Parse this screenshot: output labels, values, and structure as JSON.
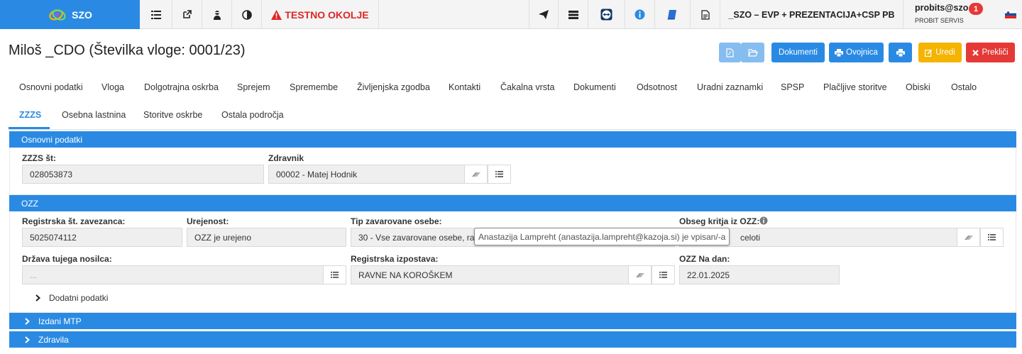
{
  "topbar": {
    "brand": "SZO",
    "env_warning": "TESTNO OKOLJE",
    "project": "_SZO – EVP + PREZENTACIJA+CSP PB",
    "user": "probits@szo",
    "organization": "PROBIT SERVIS",
    "notifications": "1",
    "icons": [
      "menu-list-icon",
      "external-link-icon",
      "user-secret-icon",
      "contrast-icon",
      "send-icon",
      "server-icon",
      "teamviewer-icon",
      "info-icon",
      "book-icon",
      "document-icon",
      "slovenia-flag-icon"
    ],
    "colors": {
      "brand_bg": "#2a8ae3",
      "warning": "#e02626",
      "badge": "#e53935"
    }
  },
  "header": {
    "title": "Miloš _CDO (Številka vloge: 0001/23)",
    "buttons": {
      "pdf_icon": "file-pdf-icon",
      "folder_icon": "folder-open-icon",
      "dokumenti": "Dokumenti",
      "ovojnica": "Ovojnica",
      "print_icon": "print-icon",
      "uredi": "Uredi",
      "preklici": "Prekliči"
    },
    "colors": {
      "primary": "#2a8ae3",
      "edit": "#f5b400",
      "cancel": "#e53935"
    }
  },
  "tabs": {
    "row1": [
      "Osnovni podatki",
      "Vloga",
      "Dolgotrajna oskrba",
      "Sprejem",
      "Spremembe",
      "Življenjska zgodba",
      "Kontakti",
      "Čakalna vrsta",
      "Dokumenti",
      "Odsotnost",
      "Uradni zaznamki",
      "SPSP",
      "Plačljive storitve",
      "Obiski",
      "Ostalo"
    ],
    "row2": [
      "ZZZS",
      "Osebna lastnina",
      "Storitve oskrbe",
      "Ostala področja"
    ],
    "active": "ZZZS"
  },
  "osnovni": {
    "heading": "Osnovni podatki",
    "zzzs_label": "ZZZS št:",
    "zzzs_value": "028053873",
    "zdravnik_label": "Zdravnik",
    "zdravnik_value": "00002 - Matej Hodnik"
  },
  "ozz": {
    "heading": "OZZ",
    "registrska_label": "Registrska št. zavezanca:",
    "registrska_value": "5025074112",
    "urejenost_label": "Urejenost:",
    "urejenost_value": "OZZ je urejeno",
    "tip_label": "Tip zavarovane osebe:",
    "tip_value": "30 - Vse zavarovane osebe, raz",
    "obseg_label": "Obseg kritja iz OZZ:",
    "obseg_value": "celoti",
    "drzava_label": "Država tujega nosilca:",
    "drzava_placeholder": "...",
    "izpostava_label": "Registrska izpostava:",
    "izpostava_value": "RAVNE NA KOROŠKEM",
    "na_dan_label": "OZZ Na dan:",
    "na_dan_value": "22.01.2025",
    "dodatni": "Dodatni podatki",
    "tooltip": "Anastazija Lampreht (anastazija.lampreht@kazoja.si) je vpisan/-a"
  },
  "sections": {
    "izdani_mtp": "Izdani MTP",
    "zdravila": "Zdravila"
  }
}
